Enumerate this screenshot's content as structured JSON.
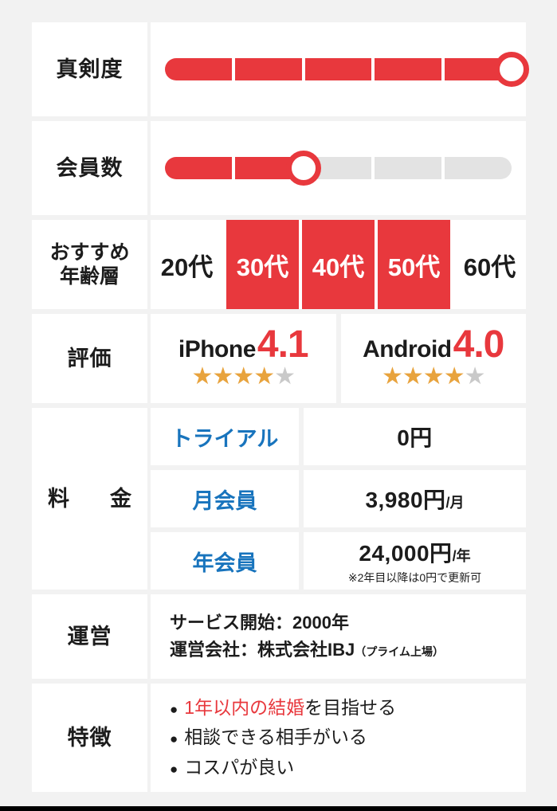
{
  "table": {
    "seriousness": {
      "label": "真剣度",
      "segments_total": 5,
      "segments_filled": 5
    },
    "members": {
      "label": "会員数",
      "segments_total": 5,
      "segments_filled": 2
    },
    "age_range": {
      "label_line1": "おすすめ",
      "label_line2": "年齢層",
      "cells": [
        {
          "text": "20代",
          "active": false
        },
        {
          "text": "30代",
          "active": true
        },
        {
          "text": "40代",
          "active": true
        },
        {
          "text": "50代",
          "active": true
        },
        {
          "text": "60代",
          "active": false
        }
      ]
    },
    "rating": {
      "label": "評価",
      "items": [
        {
          "os": "iPhone",
          "score": "4.1",
          "stars_on": 4,
          "stars_off": 1
        },
        {
          "os": "Android",
          "score": "4.0",
          "stars_on": 4,
          "stars_off": 1
        }
      ]
    },
    "price": {
      "label": "料　金",
      "rows": [
        {
          "name": "トライアル",
          "amount": "0円",
          "unit": "",
          "note": ""
        },
        {
          "name": "月会員",
          "amount": "3,980円",
          "unit": "/月",
          "note": ""
        },
        {
          "name": "年会員",
          "amount": "24,000円",
          "unit": "/年",
          "note": "※2年目以降は0円で更新可"
        }
      ]
    },
    "operator": {
      "label": "運営",
      "line1": "サービス開始：2000年",
      "line2_main": "運営会社：株式会社IBJ",
      "line2_sub": "（プライム上場）"
    },
    "feature": {
      "label": "特徴",
      "bullet": "●",
      "items": [
        {
          "highlight": "1年以内の結婚",
          "rest": "を目指せる"
        },
        {
          "highlight": "",
          "rest": "相談できる相手がいる"
        },
        {
          "highlight": "",
          "rest": "コスパが良い"
        }
      ]
    }
  },
  "colors": {
    "accent_red": "#e8383d",
    "link_blue": "#1874bd",
    "star_on": "#e8a33d",
    "star_off": "#c9c9c9",
    "track_gray": "#e3e3e3",
    "page_bg": "#f2f2f2"
  }
}
